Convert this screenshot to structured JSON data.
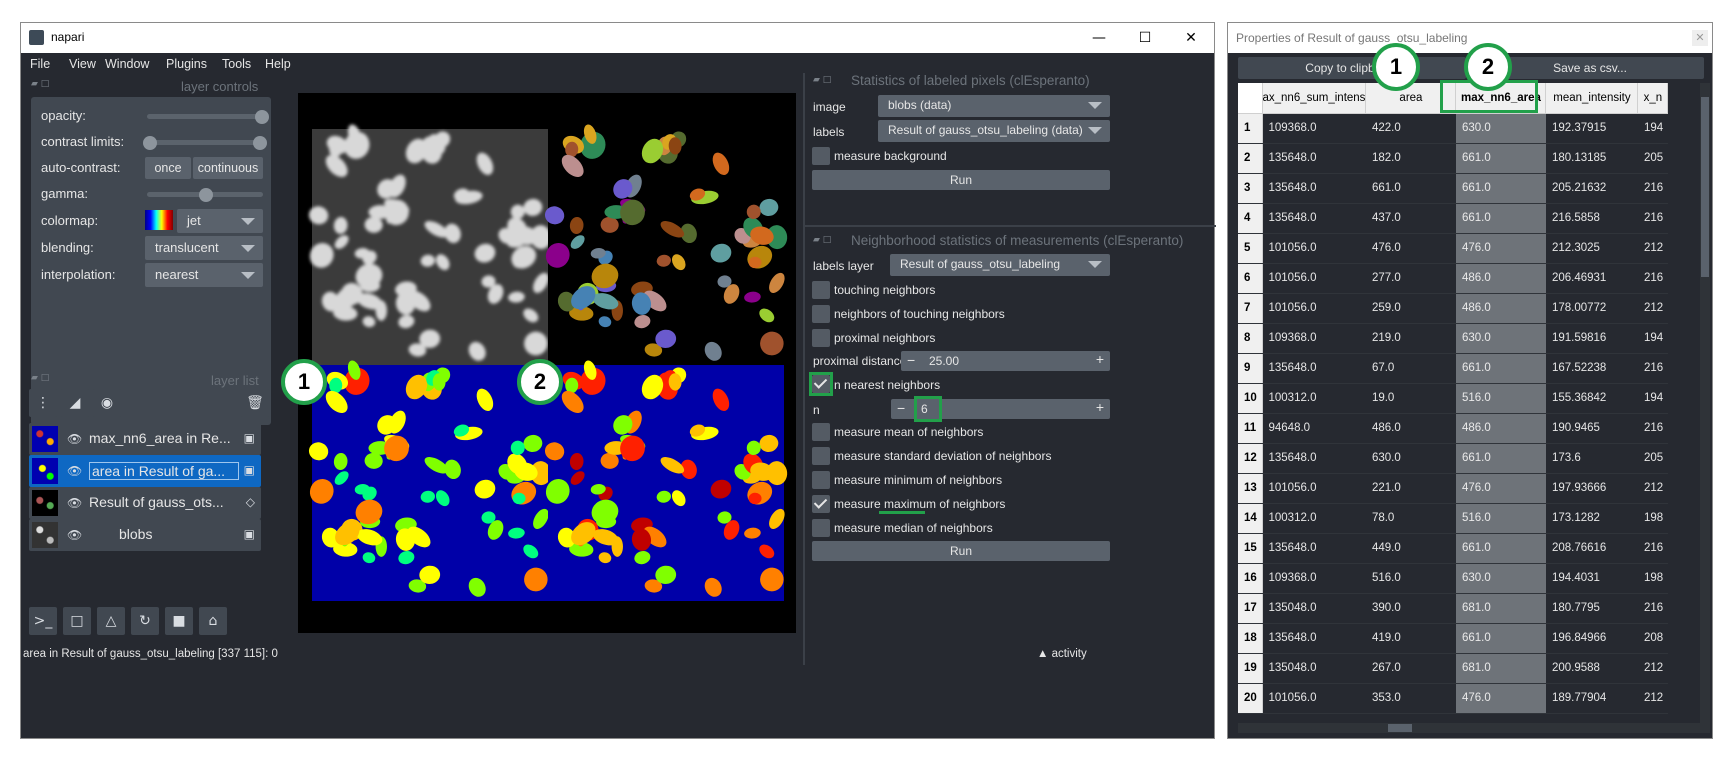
{
  "napari": {
    "title": "napari",
    "menu": [
      "File",
      "View",
      "Window",
      "Plugins",
      "Tools",
      "Help"
    ],
    "layer_controls": {
      "header": "layer controls",
      "opacity_label": "opacity:",
      "contrast_label": "contrast limits:",
      "autocontrast_label": "auto-contrast:",
      "once": "once",
      "continuous": "continuous",
      "gamma_label": "gamma:",
      "colormap_label": "colormap:",
      "colormap_value": "jet",
      "blending_label": "blending:",
      "blending_value": "translucent",
      "interpolation_label": "interpolation:",
      "interpolation_value": "nearest",
      "opacity": 1.0,
      "gamma": 0.5
    },
    "layer_list": {
      "header": "layer list",
      "layers": [
        {
          "name": "max_nn6_area in Re...",
          "type_icon": "image-icon"
        },
        {
          "name": "area in Result of ga...",
          "type_icon": "image-icon",
          "selected": true
        },
        {
          "name": "Result of gauss_ots...",
          "type_icon": "label-icon"
        },
        {
          "name": "blobs",
          "type_icon": "image-icon"
        }
      ]
    },
    "status": "area in Result of gauss_otsu_labeling [337 115]: 0",
    "activity": "activity",
    "callouts": [
      "1",
      "2"
    ]
  },
  "stats_panel": {
    "header": "Statistics of labeled pixels (clEsperanto)",
    "image_label": "image",
    "image_value": "blobs (data)",
    "labels_label": "labels",
    "labels_value": "Result of gauss_otsu_labeling (data)",
    "measure_background": "measure background",
    "run": "Run"
  },
  "neighbor_panel": {
    "header": "Neighborhood statistics of measurements (clEsperanto)",
    "labels_layer_label": "labels layer",
    "labels_layer_value": "Result of gauss_otsu_labeling",
    "touching": "touching neighbors",
    "neighbors_of_touching": "neighbors of touching neighbors",
    "proximal": "proximal neighbors",
    "proximal_distance_label": "proximal distance",
    "proximal_distance_value": "25.00",
    "n_nearest": "n nearest neighbors",
    "n_label": "n",
    "n_value": "6",
    "mean": "measure mean of neighbors",
    "std": "measure standard deviation of neighbors",
    "min": "measure minimum of neighbors",
    "max": "measure maximum of neighbors",
    "median": "measure median of neighbors",
    "run": "Run"
  },
  "properties": {
    "title": "Properties of Result of gauss_otsu_labeling",
    "copy": "Copy to clipboard",
    "save": "Save as csv...",
    "columns": [
      "ax_nn6_sum_intens",
      "area",
      "max_nn6_area",
      "mean_intensity",
      "x_n"
    ],
    "rows": [
      [
        "1",
        "109368.0",
        "422.0",
        "630.0",
        "192.37915",
        "194"
      ],
      [
        "2",
        "135648.0",
        "182.0",
        "661.0",
        "180.13185",
        "205"
      ],
      [
        "3",
        "135648.0",
        "661.0",
        "661.0",
        "205.21632",
        "216"
      ],
      [
        "4",
        "135648.0",
        "437.0",
        "661.0",
        "216.5858",
        "216"
      ],
      [
        "5",
        "101056.0",
        "476.0",
        "476.0",
        "212.3025",
        "212"
      ],
      [
        "6",
        "101056.0",
        "277.0",
        "486.0",
        "206.46931",
        "216"
      ],
      [
        "7",
        "101056.0",
        "259.0",
        "486.0",
        "178.00772",
        "212"
      ],
      [
        "8",
        "109368.0",
        "219.0",
        "630.0",
        "191.59816",
        "194"
      ],
      [
        "9",
        "135648.0",
        "67.0",
        "661.0",
        "167.52238",
        "216"
      ],
      [
        "10",
        "100312.0",
        "19.0",
        "516.0",
        "155.36842",
        "194"
      ],
      [
        "11",
        "94648.0",
        "486.0",
        "486.0",
        "190.9465",
        "216"
      ],
      [
        "12",
        "135648.0",
        "630.0",
        "661.0",
        "173.6",
        "205"
      ],
      [
        "13",
        "101056.0",
        "221.0",
        "476.0",
        "197.93666",
        "212"
      ],
      [
        "14",
        "100312.0",
        "78.0",
        "516.0",
        "173.1282",
        "198"
      ],
      [
        "15",
        "135648.0",
        "449.0",
        "661.0",
        "208.76616",
        "216"
      ],
      [
        "16",
        "109368.0",
        "516.0",
        "630.0",
        "194.4031",
        "198"
      ],
      [
        "17",
        "135048.0",
        "390.0",
        "681.0",
        "180.7795",
        "216"
      ],
      [
        "18",
        "135648.0",
        "419.0",
        "661.0",
        "196.84966",
        "208"
      ],
      [
        "19",
        "135048.0",
        "267.0",
        "681.0",
        "200.9588",
        "212"
      ],
      [
        "20",
        "101056.0",
        "353.0",
        "476.0",
        "189.77904",
        "212"
      ]
    ]
  }
}
